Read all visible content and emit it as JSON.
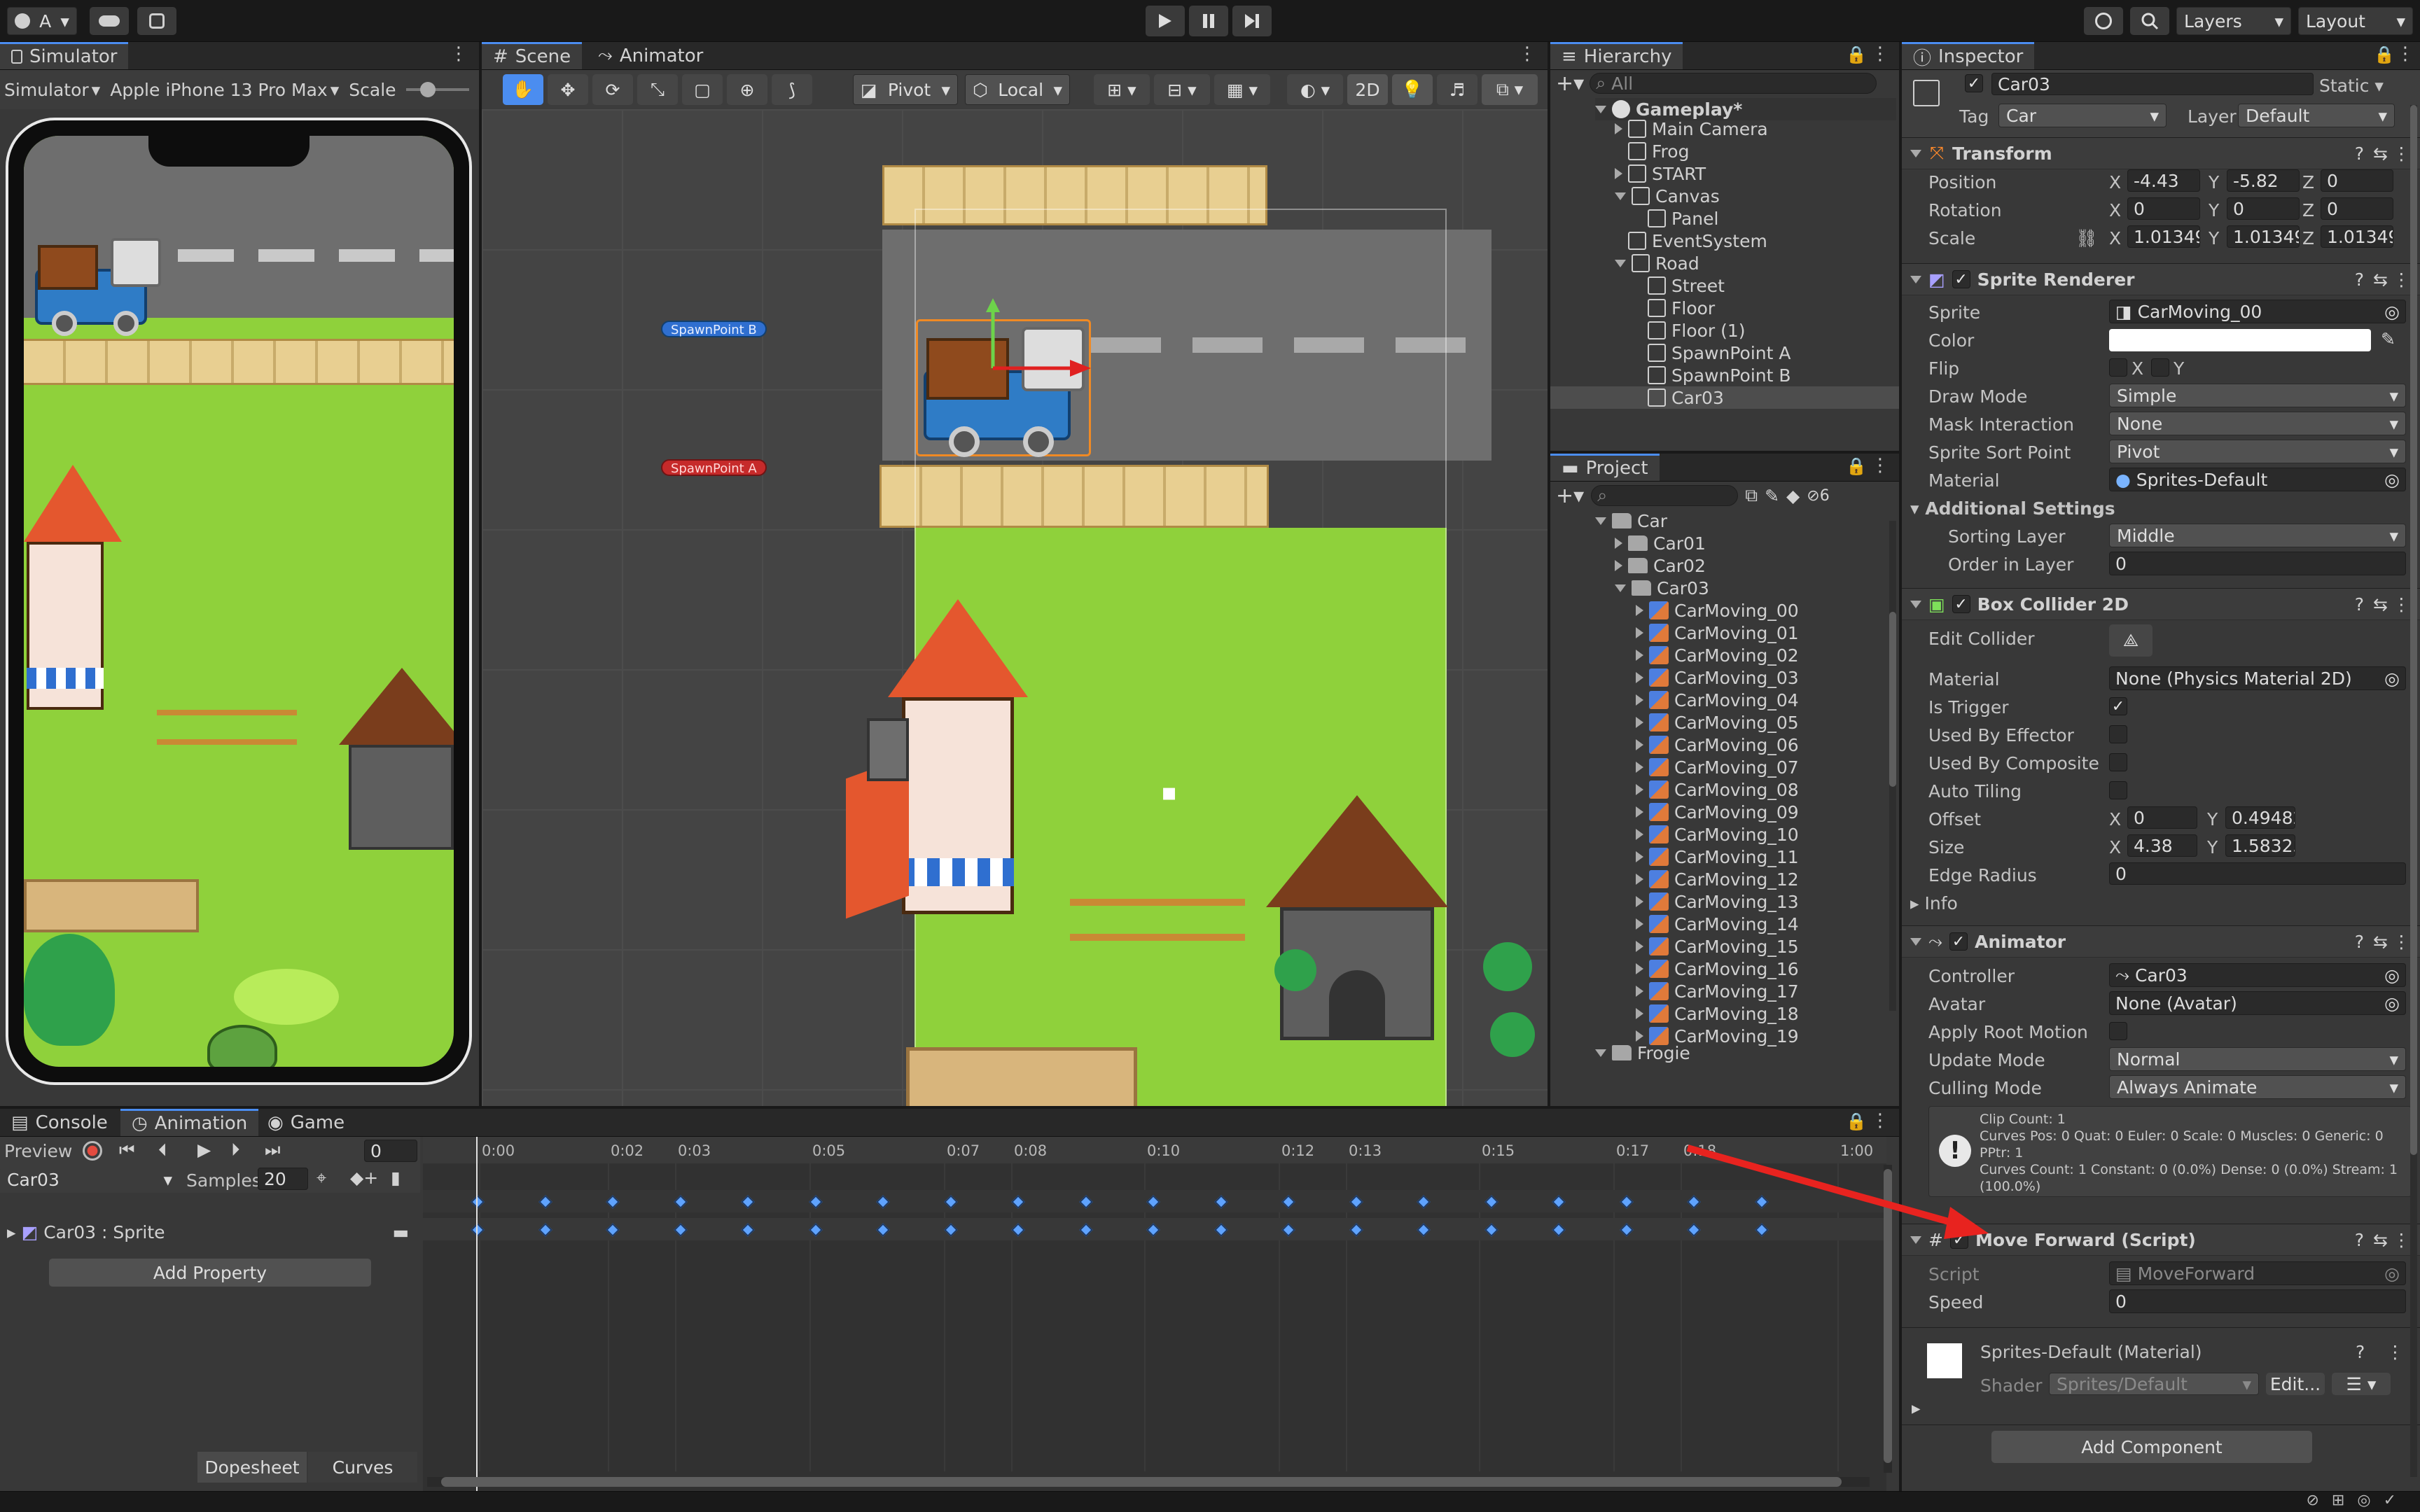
{
  "toolbar": {
    "account": "A",
    "layers": "Layers",
    "layout": "Layout"
  },
  "simulator": {
    "tab": "Simulator",
    "mode": "Simulator",
    "device": "Apple iPhone 13 Pro Max",
    "scale_label": "Scale"
  },
  "scene": {
    "tab_scene": "Scene",
    "tab_animator": "Animator",
    "pivot": "Pivot",
    "local": "Local",
    "mode2d": "2D",
    "spawn_b": "SpawnPoint B",
    "spawn_a": "SpawnPoint A"
  },
  "hierarchy": {
    "tab": "Hierarchy",
    "search_placeholder": "All",
    "root": "Gameplay*",
    "items": [
      "Main Camera",
      "Frog",
      "START",
      "Canvas",
      "Panel",
      "EventSystem",
      "Road",
      "Street",
      "Floor",
      "Floor (1)",
      "SpawnPoint A",
      "SpawnPoint B",
      "Car03"
    ]
  },
  "project": {
    "tab": "Project",
    "hidden_count": "6",
    "folder": "Car",
    "subfolders": [
      "Car01",
      "Car02",
      "Car03"
    ],
    "sprites": [
      "CarMoving_00",
      "CarMoving_01",
      "CarMoving_02",
      "CarMoving_03",
      "CarMoving_04",
      "CarMoving_05",
      "CarMoving_06",
      "CarMoving_07",
      "CarMoving_08",
      "CarMoving_09",
      "CarMoving_10",
      "CarMoving_11",
      "CarMoving_12",
      "CarMoving_13",
      "CarMoving_14",
      "CarMoving_15",
      "CarMoving_16",
      "CarMoving_17",
      "CarMoving_18",
      "CarMoving_19"
    ],
    "next_folder": "Frogie"
  },
  "inspector": {
    "tab": "Inspector",
    "name": "Car03",
    "static": "Static",
    "tag_label": "Tag",
    "tag": "Car",
    "layer_label": "Layer",
    "layer": "Default",
    "transform": {
      "title": "Transform",
      "position_label": "Position",
      "rotation_label": "Rotation",
      "scale_label": "Scale",
      "pos": [
        "-4.43",
        "-5.82",
        "0"
      ],
      "rot": [
        "0",
        "0",
        "0"
      ],
      "scale": [
        "1.01349",
        "1.01349",
        "1.01349"
      ]
    },
    "sprite_renderer": {
      "title": "Sprite Renderer",
      "sprite_label": "Sprite",
      "sprite": "CarMoving_00",
      "color_label": "Color",
      "flip_label": "Flip",
      "draw_mode_label": "Draw Mode",
      "draw_mode": "Simple",
      "mask_label": "Mask Interaction",
      "mask": "None",
      "sort_point_label": "Sprite Sort Point",
      "sort_point": "Pivot",
      "material_label": "Material",
      "material": "Sprites-Default",
      "additional": "Additional Settings",
      "sorting_layer_label": "Sorting Layer",
      "sorting_layer": "Middle",
      "order_label": "Order in Layer",
      "order": "0"
    },
    "box_collider": {
      "title": "Box Collider 2D",
      "edit_label": "Edit Collider",
      "material_label": "Material",
      "material": "None (Physics Material 2D)",
      "trigger_label": "Is Trigger",
      "effector_label": "Used By Effector",
      "composite_label": "Used By Composite",
      "tiling_label": "Auto Tiling",
      "offset_label": "Offset",
      "offset": [
        "0",
        "0.49482"
      ],
      "size_label": "Size",
      "size": [
        "4.38",
        "1.58323"
      ],
      "radius_label": "Edge Radius",
      "radius": "0",
      "info": "Info"
    },
    "animator": {
      "title": "Animator",
      "controller_label": "Controller",
      "controller": "Car03",
      "avatar_label": "Avatar",
      "avatar": "None (Avatar)",
      "root_motion_label": "Apply Root Motion",
      "update_label": "Update Mode",
      "update": "Normal",
      "culling_label": "Culling Mode",
      "culling": "Always Animate",
      "info_lines": [
        "Clip Count: 1",
        "Curves Pos: 0 Quat: 0 Euler: 0 Scale: 0 Muscles: 0 Generic: 0 PPtr: 1",
        "Curves Count: 1 Constant: 0 (0.0%) Dense: 0 (0.0%) Stream: 1 (100.0%)"
      ]
    },
    "move_forward": {
      "title": "Move Forward (Script)",
      "script_label": "Script",
      "script": "MoveForward",
      "speed_label": "Speed",
      "speed": "0"
    },
    "material": {
      "title": "Sprites-Default (Material)",
      "shader_label": "Shader",
      "shader": "Sprites/Default",
      "edit": "Edit..."
    },
    "add_component": "Add Component"
  },
  "animation": {
    "tab_console": "Console",
    "tab_animation": "Animation",
    "tab_game": "Game",
    "preview": "Preview",
    "frame": "0",
    "clip": "Car03",
    "samples_label": "Samples",
    "samples": "20",
    "property": "Car03 : Sprite",
    "add_property": "Add Property",
    "dopesheet": "Dopesheet",
    "curves": "Curves",
    "ticks": [
      "0:00",
      "0:02",
      "0:03",
      "0:05",
      "0:07",
      "0:08",
      "0:10",
      "0:12",
      "0:13",
      "0:15",
      "0:17",
      "0:18",
      "1:00"
    ]
  },
  "colors": {
    "accent": "#4b8df0",
    "annotation_arrow": "#e8231f",
    "grass": "#8fd13b",
    "road": "#6e6e6e"
  }
}
